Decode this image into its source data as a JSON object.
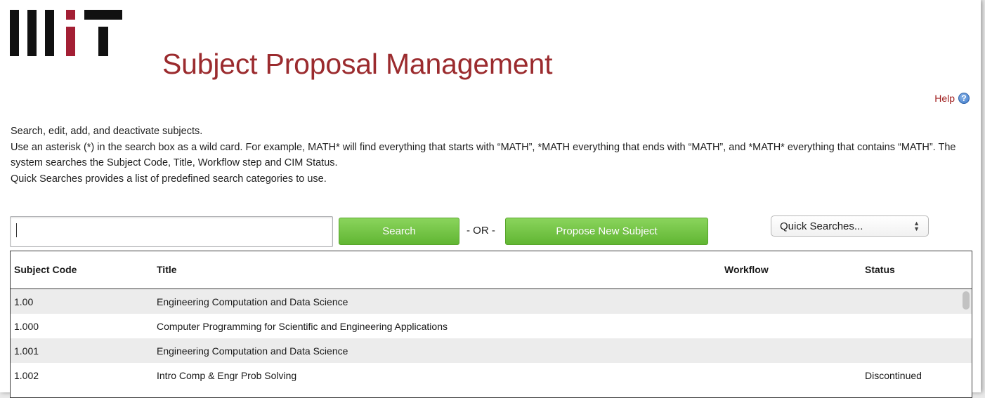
{
  "header": {
    "title": "Subject Proposal Management",
    "logo_icon": "mit-logo-icon",
    "help_label": "Help",
    "help_icon": "question-circle-icon"
  },
  "description": {
    "line1": "Search, edit, add, and deactivate subjects.",
    "line2": "Use an asterisk (*) in the search box as a wild card. For example, MATH* will find everything that starts with “MATH”, *MATH everything that ends with “MATH”, and *MATH* everything that contains “MATH”. The system searches the Subject Code, Title, Workflow step and CIM Status.",
    "line3": "Quick Searches provides a list of predefined search categories to use."
  },
  "search": {
    "value": "",
    "placeholder": "",
    "button_label": "Search",
    "or_label": "- OR -",
    "propose_label": "Propose New Subject",
    "quick_searches_label": "Quick Searches..."
  },
  "table": {
    "headers": {
      "code": "Subject Code",
      "title": "Title",
      "workflow": "Workflow",
      "status": "Status"
    },
    "rows": [
      {
        "code": "1.00",
        "title": "Engineering Computation and Data Science",
        "workflow": "",
        "status": ""
      },
      {
        "code": "1.000",
        "title": "Computer Programming for Scientific and Engineering Applications",
        "workflow": "",
        "status": ""
      },
      {
        "code": "1.001",
        "title": "Engineering Computation and Data Science",
        "workflow": "",
        "status": ""
      },
      {
        "code": "1.002",
        "title": "Intro Comp & Engr Prob Solving",
        "workflow": "",
        "status": "Discontinued"
      }
    ]
  },
  "colors": {
    "brand_red": "#9b2b2e",
    "button_green": "#6cc03c",
    "row_alt": "#ececec",
    "logo_dark": "#111111",
    "logo_red": "#a31f34"
  }
}
